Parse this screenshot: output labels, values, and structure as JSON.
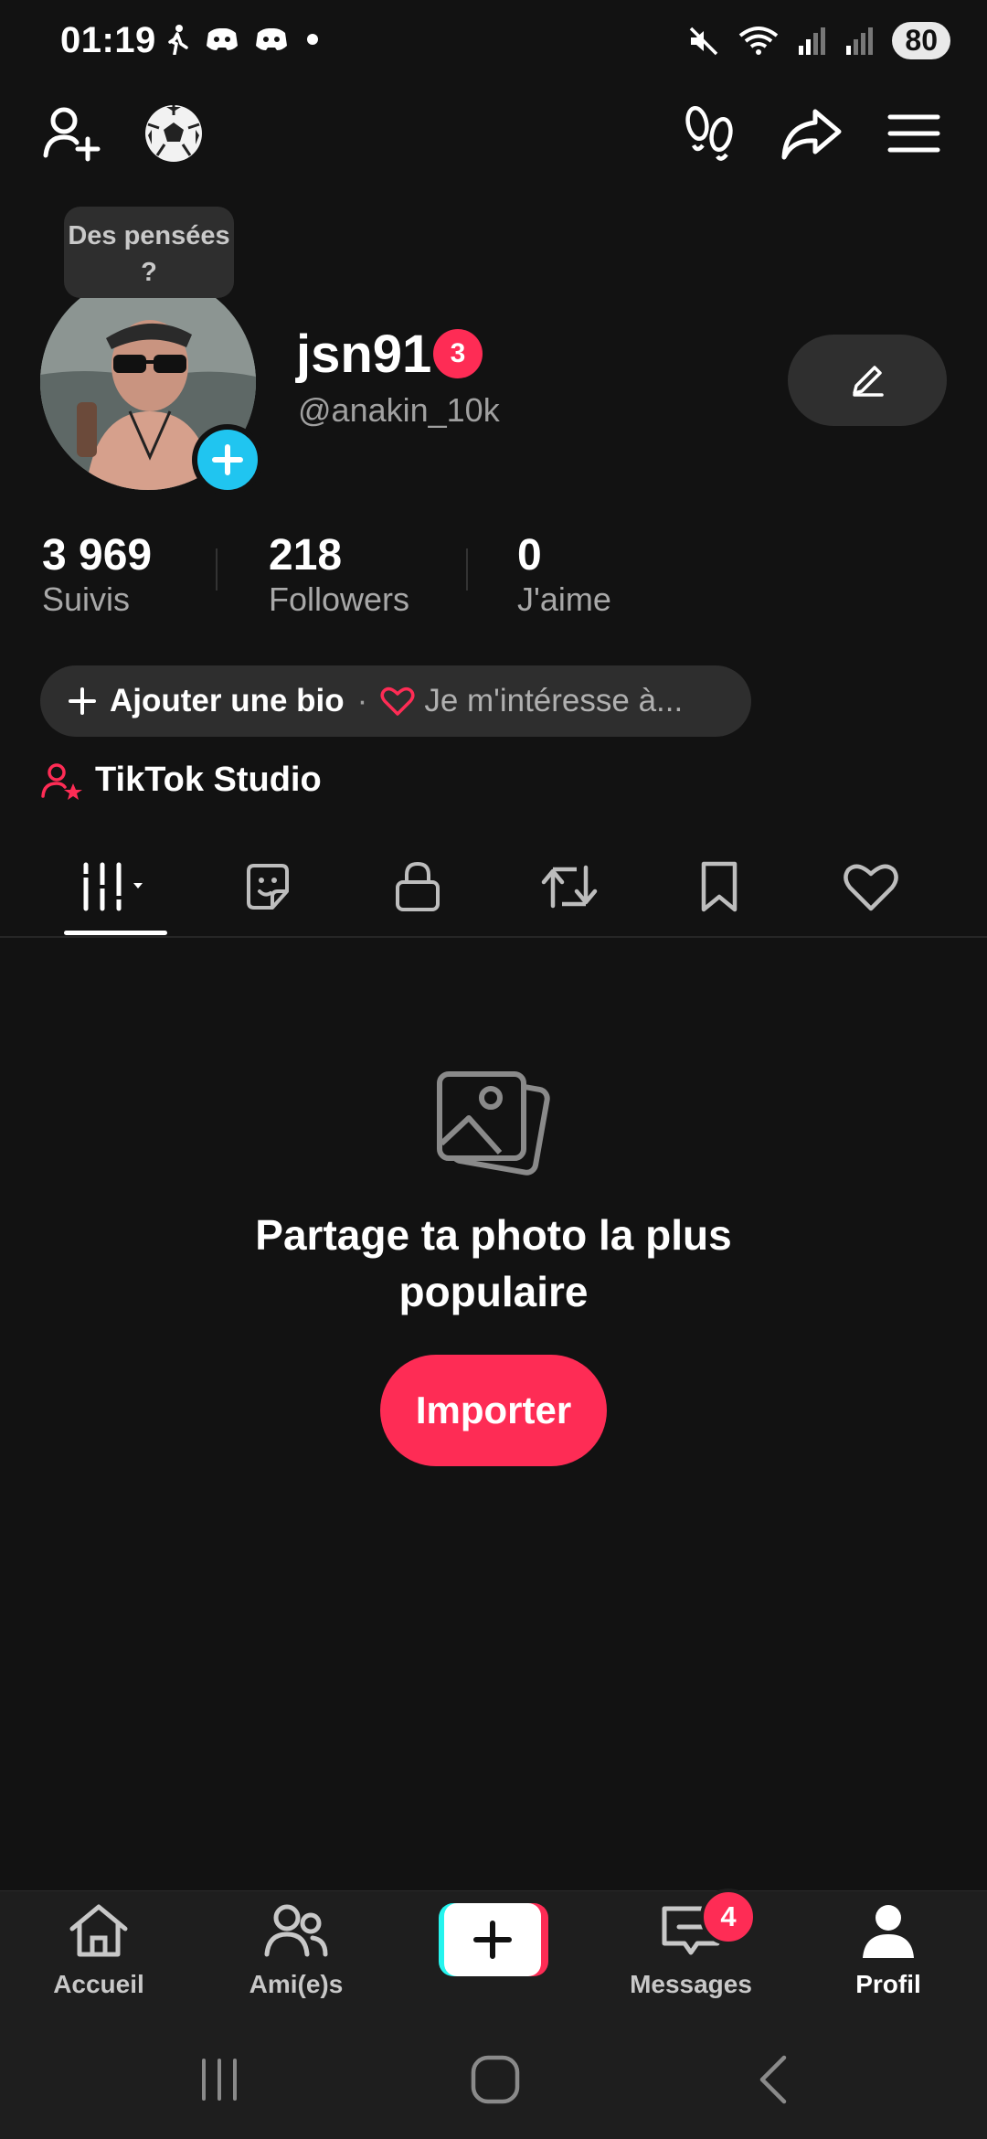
{
  "status_bar": {
    "time": "01:19",
    "battery": "80"
  },
  "profile": {
    "thought_bubble": "Des pensées ?",
    "username": "jsn91",
    "notification_count": "3",
    "handle": "@anakin_10k"
  },
  "stats": [
    {
      "value": "3 969",
      "label": "Suivis"
    },
    {
      "value": "218",
      "label": "Followers"
    },
    {
      "value": "0",
      "label": "J'aime"
    }
  ],
  "bio": {
    "add_label": "Ajouter une bio",
    "separator": "·",
    "interest_label": "Je m'intéresse à..."
  },
  "studio_label": "TikTok Studio",
  "tabs": [
    "videos-grid",
    "stickers",
    "private",
    "reposts",
    "saved",
    "liked"
  ],
  "empty_state": {
    "title_line1": "Partage ta photo la plus",
    "title_line2": "populaire",
    "button": "Importer"
  },
  "bottom_nav": {
    "home": "Accueil",
    "friends": "Ami(e)s",
    "messages": "Messages",
    "messages_badge": "4",
    "profile": "Profil"
  },
  "colors": {
    "accent": "#fe2c55",
    "cyan": "#20c5f0",
    "background": "#121212"
  }
}
